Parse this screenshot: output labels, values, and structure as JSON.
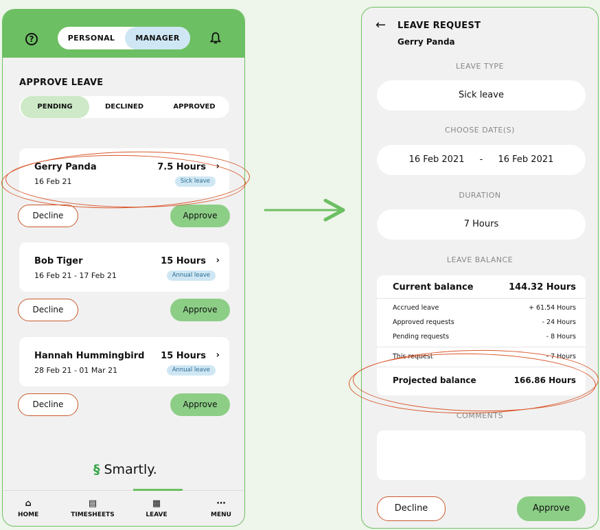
{
  "manager_screen": {
    "toggle": {
      "personal": "PERSONAL",
      "manager": "MANAGER"
    },
    "title": "APPROVE LEAVE",
    "tabs": [
      "PENDING",
      "DECLINED",
      "APPROVED"
    ],
    "requests": [
      {
        "name": "Gerry Panda",
        "dates": "16 Feb 21",
        "hours": "7.5 Hours",
        "type": "Sick leave"
      },
      {
        "name": "Bob Tiger",
        "dates": "16 Feb 21 - 17 Feb 21",
        "hours": "15 Hours",
        "type": "Annual leave"
      },
      {
        "name": "Hannah Hummingbird",
        "dates": "28 Feb 21 - 01 Mar 21",
        "hours": "15 Hours",
        "type": "Annual leave"
      }
    ],
    "decline_label": "Decline",
    "approve_label": "Approve",
    "chevron": "›",
    "logo": "Smartly.",
    "nav": [
      {
        "label": "HOME",
        "icon": "home-icon",
        "glyph": "⌂"
      },
      {
        "label": "TIMESHEETS",
        "icon": "timesheets-icon",
        "glyph": "▤"
      },
      {
        "label": "LEAVE",
        "icon": "calendar-icon",
        "glyph": "▦"
      },
      {
        "label": "MENU",
        "icon": "more-icon",
        "glyph": "⋯"
      }
    ]
  },
  "request_screen": {
    "back_glyph": "←",
    "title": "LEAVE REQUEST",
    "employee": "Gerry Panda",
    "leave_type_label": "LEAVE TYPE",
    "leave_type": "Sick leave",
    "dates_label": "CHOOSE DATE(S)",
    "date_from": "16 Feb 2021",
    "date_sep": "-",
    "date_to": "16 Feb 2021",
    "duration_label": "DURATION",
    "duration": "7 Hours",
    "balance_label": "LEAVE BALANCE",
    "balance": {
      "current_label": "Current balance",
      "current": "144.32 Hours",
      "accrued_label": "Accrued leave",
      "accrued": "+ 61.54 Hours",
      "approved_label": "Approved requests",
      "approved": "- 24 Hours",
      "pending_label": "Pending requests",
      "pending": "- 8 Hours",
      "this_label": "This request",
      "this": "- 7 Hours",
      "projected_label": "Projected balance",
      "projected": "166.86 Hours"
    },
    "comments_label": "COMMENTS",
    "decline_label": "Decline",
    "approve_label": "Approve"
  },
  "colors": {
    "brand_green": "#6cbf62",
    "approve_green": "#8cce86",
    "decline_orange": "#c9572a",
    "badge_blue": "#cfe7f4",
    "annotation_orange": "#d9562a"
  }
}
